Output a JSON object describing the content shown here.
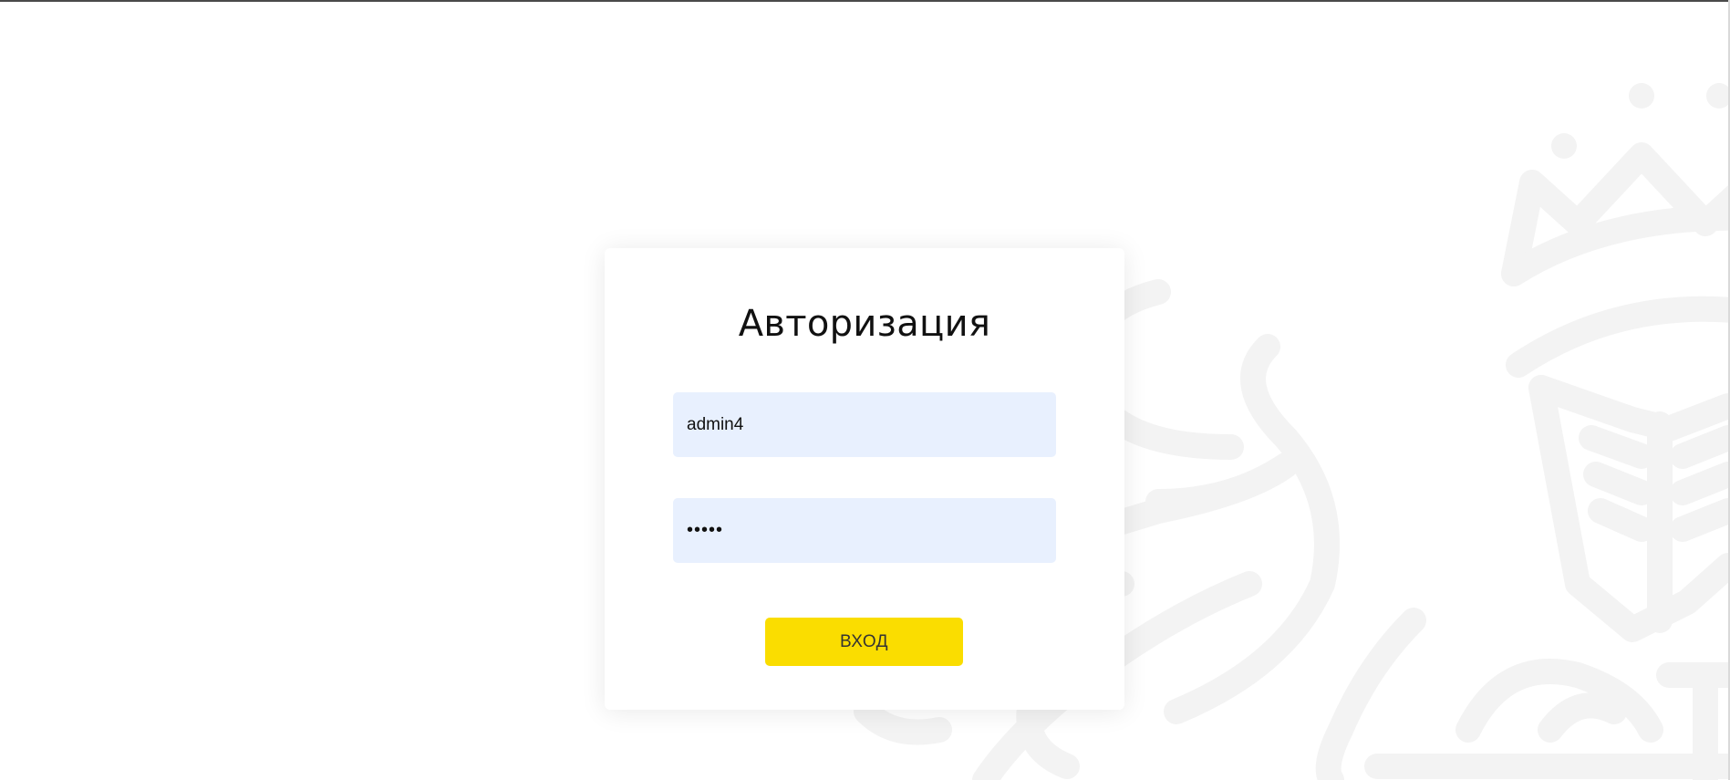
{
  "auth": {
    "title": "Авторизация",
    "login_value": "admin4",
    "password_value": "•••••",
    "submit_label": "ВХОД"
  },
  "colors": {
    "accent": "#fadd00",
    "input_bg": "#e8f0fe",
    "emblem_stroke": "#f4f4f4"
  },
  "icons": [
    "emblem-watermark-icon"
  ]
}
